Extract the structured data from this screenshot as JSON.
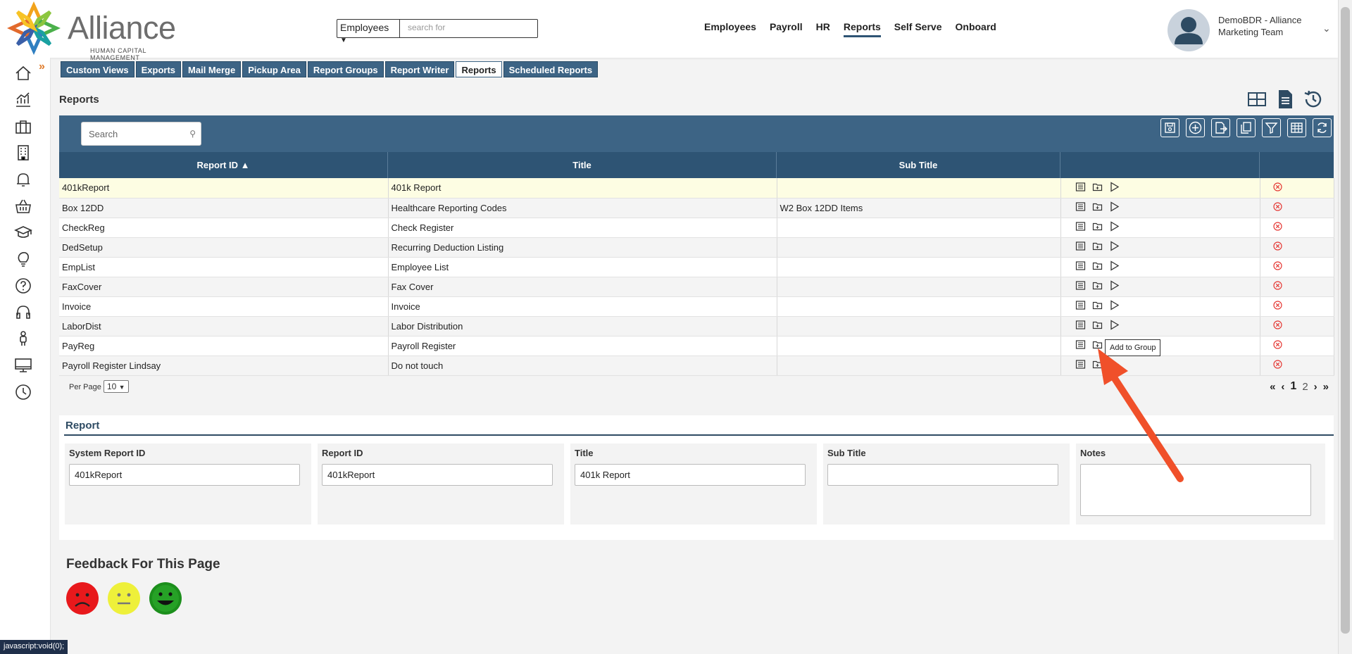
{
  "header": {
    "logo_text": "Alliance",
    "logo_sub": "HUMAN CAPITAL MANAGEMENT",
    "search_select": "Employees",
    "search_placeholder": "search for",
    "nav": [
      "Employees",
      "Payroll",
      "HR",
      "Reports",
      "Self Serve",
      "Onboard"
    ],
    "active_nav": "Reports",
    "user_name": "DemoBDR - Alliance Marketing Team"
  },
  "subtabs": [
    "Custom Views",
    "Exports",
    "Mail Merge",
    "Pickup Area",
    "Report Groups",
    "Report Writer",
    "Reports",
    "Scheduled Reports"
  ],
  "active_subtab": "Reports",
  "page_title": "Reports",
  "grid": {
    "search_placeholder": "Search",
    "columns": [
      "Report ID ▲",
      "Title",
      "Sub Title",
      "",
      ""
    ],
    "rows": [
      {
        "id": "401kReport",
        "title": "401k Report",
        "subtitle": ""
      },
      {
        "id": "Box 12DD",
        "title": "Healthcare Reporting Codes",
        "subtitle": "W2 Box 12DD Items"
      },
      {
        "id": "CheckReg",
        "title": "Check Register",
        "subtitle": ""
      },
      {
        "id": "DedSetup",
        "title": "Recurring Deduction Listing",
        "subtitle": ""
      },
      {
        "id": "EmpList",
        "title": "Employee List",
        "subtitle": ""
      },
      {
        "id": "FaxCover",
        "title": "Fax Cover",
        "subtitle": ""
      },
      {
        "id": "Invoice",
        "title": "Invoice",
        "subtitle": ""
      },
      {
        "id": "LaborDist",
        "title": "Labor Distribution",
        "subtitle": ""
      },
      {
        "id": "PayReg",
        "title": "Payroll Register",
        "subtitle": ""
      },
      {
        "id": "Payroll Register Lindsay",
        "title": "Do not touch",
        "subtitle": ""
      }
    ],
    "per_page_label": "Per Page",
    "per_page_value": "10",
    "pages": [
      "1",
      "2"
    ],
    "current_page": "1",
    "tooltip": "Add to Group"
  },
  "report": {
    "section_title": "Report",
    "fields": [
      {
        "label": "System Report ID",
        "value": "401kReport"
      },
      {
        "label": "Report ID",
        "value": "401kReport"
      },
      {
        "label": "Title",
        "value": "401k Report"
      },
      {
        "label": "Sub Title",
        "value": ""
      },
      {
        "label": "Notes",
        "value": ""
      }
    ]
  },
  "feedback_title": "Feedback For This Page",
  "status_bar": "javascript:void(0);",
  "colors": {
    "nav_blue": "#3d6485",
    "header_dark": "#2e5474",
    "accent_orange": "#e07b2a",
    "arrow_red": "#f0502a",
    "delete_red": "#e53935"
  }
}
